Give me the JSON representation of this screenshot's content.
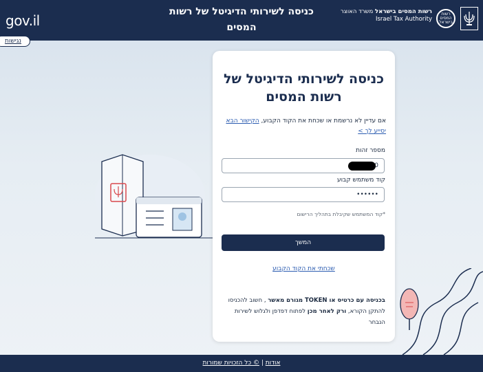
{
  "header": {
    "logo_text_light": "gov",
    "logo_text_bold": "v",
    "logo_text_suffix": ".il",
    "title_line1": "כניסה לשירותי הדיגיטל של רשות",
    "title_line2": "המסים",
    "authority_he_bold": "רשות המסים בישראל",
    "authority_he_sub": "משרד האוצר",
    "authority_en": "Israel Tax Authority",
    "emblem_text": "רשות המסים בישראל",
    "accessibility_label": "נגישות"
  },
  "card": {
    "title": "כניסה לשירותי הדיגיטל של רשות המסים",
    "intro_text": "אם עדיין לא נרשמת או שכחת את הקוד הקבוע, ",
    "intro_link": "הקישור הבא יסייע לך >",
    "id_label": "מספר זהות",
    "id_value": "0",
    "code_label": "קוד משתמש קבוע",
    "code_value": "••••••",
    "code_hint": "*קוד המשתמש שקיבלת בתהליך הרישום",
    "continue_label": "המשך",
    "forgot_link": "שכחתי את הקוד הקבוע",
    "note_part1": "בכניסה עם כרטיס או TOKEN מגורם מאשר",
    "note_part2": " , חשוב להכניסו להתקן הקורא, ",
    "note_part3": "ורק לאחר מכן",
    "note_part4": " לפתוח דפדפן ולגלוש לשירות הנבחר"
  },
  "footer": {
    "about": "אודות",
    "separator": " | ",
    "copyright": "© כל הזכויות שמורות"
  },
  "colors": {
    "navy": "#1b2d4f",
    "link": "#2a5bb0",
    "accent_red": "#d9484c"
  }
}
